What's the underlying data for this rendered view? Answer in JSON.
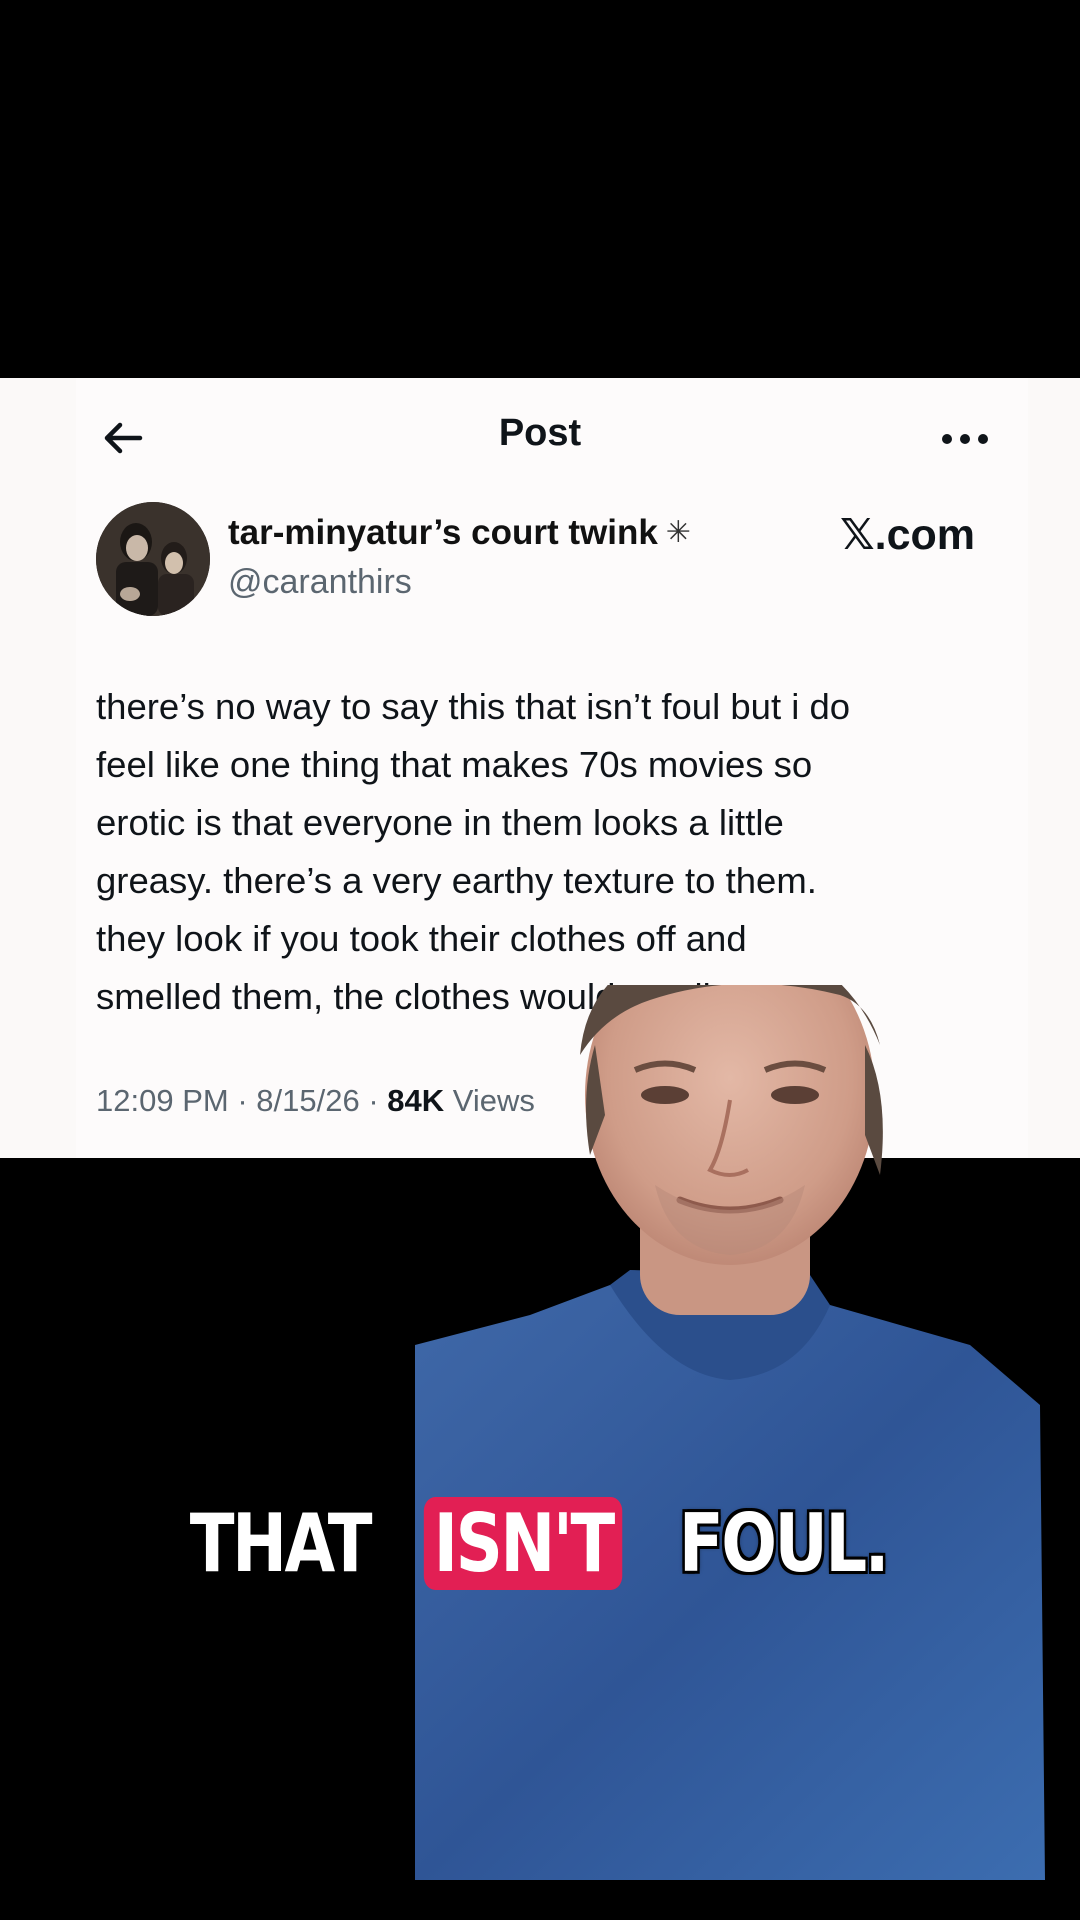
{
  "header": {
    "title": "Post"
  },
  "author": {
    "display_name": "tar-minyatur’s court twink",
    "badge_glyph": "✳",
    "handle": "@caranthirs"
  },
  "watermark": "𝕏.com",
  "tweet": {
    "lines": [
      "there’s no way to say this that isn’t foul but i do",
      "feel like one thing that makes 70s movies so",
      "erotic is that everyone in them looks a little",
      "greasy. there’s a very earthy texture to them.",
      "they look if you took their clothes off and",
      "smelled them, the clothes would smell worn"
    ]
  },
  "meta": {
    "time": "12:09 PM",
    "date": "8/15/26",
    "separator": "·",
    "views_count": "84K",
    "views_label": "Views"
  },
  "caption": {
    "words": [
      "THAT",
      "ISN'T",
      "FOUL."
    ],
    "highlight_index": 1,
    "highlight_color": "#e21f54"
  },
  "colors": {
    "card_background": "#fdfbfb",
    "text_primary": "#0f1419",
    "text_secondary": "#5b6670",
    "shirt_blue": "#3a5f9e"
  },
  "icons": {
    "back": "back-arrow-icon",
    "more": "more-horizontal-icon",
    "badge": "sparkle-icon"
  }
}
